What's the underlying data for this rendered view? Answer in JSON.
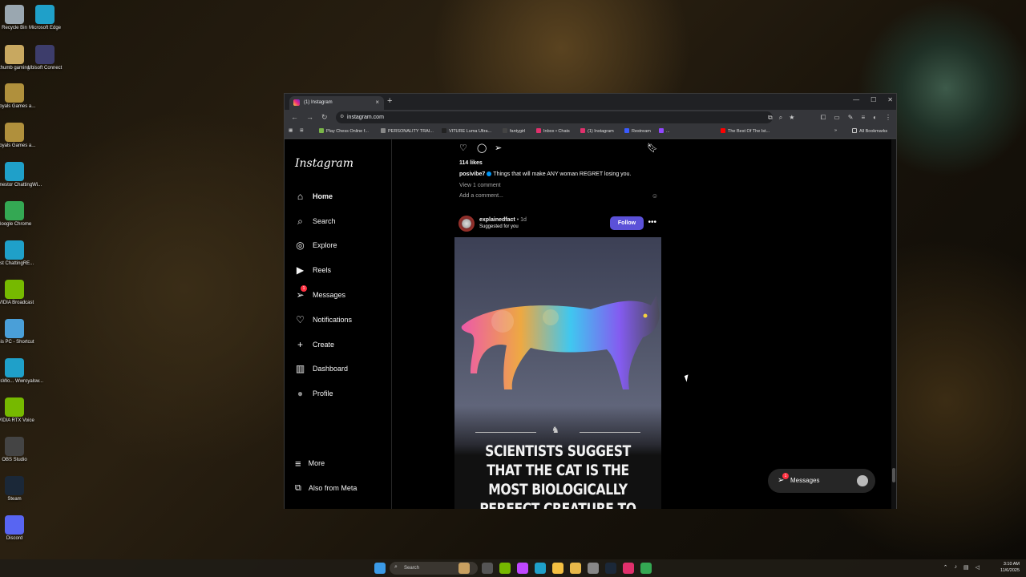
{
  "desktop": {
    "icons": [
      {
        "label": "Recycle Bin",
        "color": "#9aa7b0"
      },
      {
        "label": "Microsoft Edge",
        "color": "#1fa0c9"
      },
      {
        "label": "thumb gaming",
        "color": "#c8a860"
      },
      {
        "label": "Ubisoft Connect",
        "color": "#3d3d6b"
      },
      {
        "label": "Wroyals Games a...",
        "color": "#b0903c"
      },
      {
        "label": "Wroyals Games a...",
        "color": "#b0903c"
      },
      {
        "label": "Carolinestor ChattingWi...",
        "color": "#1fa0c9"
      },
      {
        "label": "Google Chrome",
        "color": "#34a853"
      },
      {
        "label": "Just ChattingRE...",
        "color": "#1fa0c9"
      },
      {
        "label": "NVIDIA Broadcast",
        "color": "#76b900"
      },
      {
        "label": "This PC - Shortcut",
        "color": "#4a9fd8"
      },
      {
        "label": "WroyalsWo... Wwroyalsw...",
        "color": "#1fa0c9"
      },
      {
        "label": "NVIDIA RTX Voice",
        "color": "#76b900"
      },
      {
        "label": "OBS Studio",
        "color": "#444"
      },
      {
        "label": "Steam",
        "color": "#1b2838"
      },
      {
        "label": "Discord",
        "color": "#5865f2"
      }
    ]
  },
  "browser": {
    "tab_title": "(1) Instagram",
    "tab_close": "×",
    "new_tab": "+",
    "url": "instagram.com",
    "bookmarks": [
      {
        "label": "Play Chess Online f...",
        "color": "#7ab648"
      },
      {
        "label": "PERSONALITY TRAI...",
        "color": "#888"
      },
      {
        "label": "VITURE Luma Ultra...",
        "color": "#222"
      },
      {
        "label": "fantygirl",
        "color": "#444"
      },
      {
        "label": "Inbox • Chats",
        "color": "#e1306c"
      },
      {
        "label": "(1) Instagram",
        "color": "#e1306c"
      },
      {
        "label": "Restream",
        "color": "#3a5bff"
      },
      {
        "label": "...",
        "color": "#9147ff"
      },
      {
        "label": "The Best Of The Ist...",
        "color": "#ff0000"
      }
    ],
    "all_bookmarks": "All Bookmarks",
    "more_chevron": "»"
  },
  "instagram": {
    "logo": "Instagram",
    "nav": [
      {
        "label": "Home",
        "icon": "home-icon",
        "bold": true
      },
      {
        "label": "Search",
        "icon": "search-icon"
      },
      {
        "label": "Explore",
        "icon": "explore-icon"
      },
      {
        "label": "Reels",
        "icon": "reels-icon"
      },
      {
        "label": "Messages",
        "icon": "messages-icon",
        "badge": "1"
      },
      {
        "label": "Notifications",
        "icon": "heart-icon"
      },
      {
        "label": "Create",
        "icon": "plus-icon"
      },
      {
        "label": "Dashboard",
        "icon": "dashboard-icon"
      },
      {
        "label": "Profile",
        "icon": "profile-avatar"
      }
    ],
    "more": "More",
    "also_from_meta": "Also from Meta",
    "previous_post": {
      "likes": "114 likes",
      "username": "posivibe7",
      "caption": "Things that will make ANY woman REGRET losing you.",
      "view_comments": "View 1 comment",
      "add_comment": "Add a comment..."
    },
    "post": {
      "username": "explainedfact",
      "time": "• 1d",
      "subtitle": "Suggested for you",
      "follow": "Follow",
      "headline": "SCIENTISTS SUGGEST THAT THE CAT IS THE MOST BIOLOGICALLY PERFECT CREATURE TO EXIST"
    },
    "messages_float": {
      "label": "Messages",
      "badge": "1"
    },
    "accent": "#5b51d8"
  },
  "taskbar": {
    "search": "Search",
    "time": "3:10 AM",
    "date": "11/6/2025"
  }
}
